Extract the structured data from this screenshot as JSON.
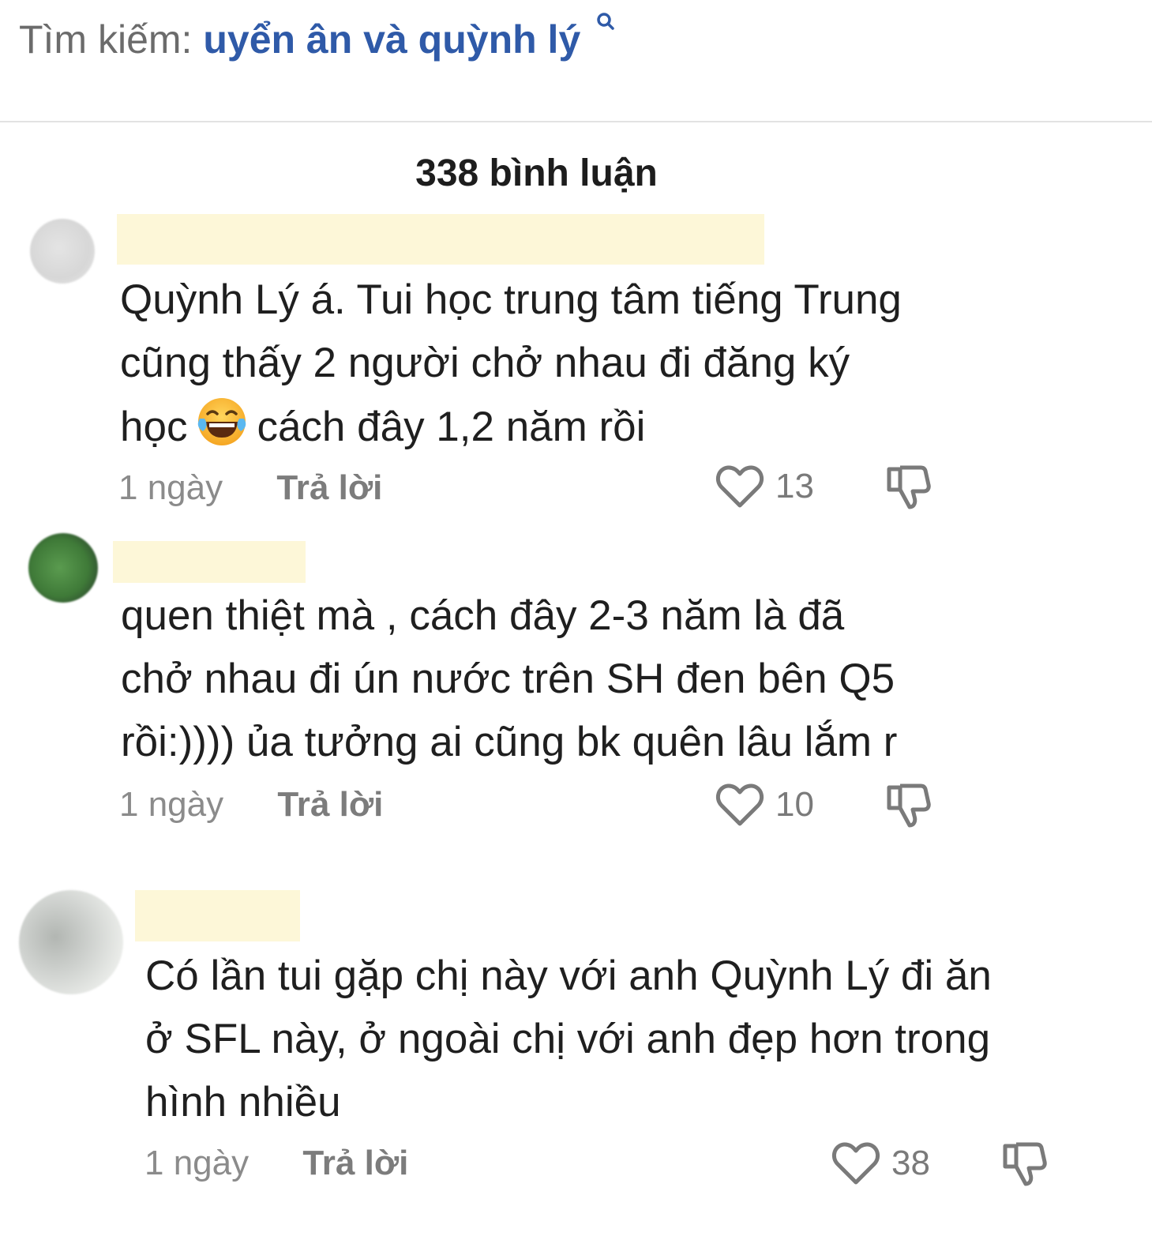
{
  "search": {
    "label": "Tìm kiếm:",
    "query": "uyển ân và quỳnh lý"
  },
  "comments_header": {
    "count_text": "338 bình luận"
  },
  "comments": [
    {
      "text_before_emoji": "Quỳnh Lý á. Tui học trung tâm tiếng Trung\ncũng thấy 2 người chở nhau đi đăng ký\nhọc",
      "emoji": "laughing-crying-emoji",
      "text_after_emoji": "cách đây 1,2 năm rồi",
      "time": "1 ngày",
      "reply_label": "Trả lời",
      "likes": "13"
    },
    {
      "text": "quen thiệt mà , cách đây 2-3 năm là đã\nchở nhau đi ún nước trên SH đen bên Q5\nrồi:)))) ủa tưởng ai cũng bk quên lâu lắm r",
      "time": "1 ngày",
      "reply_label": "Trả lời",
      "likes": "10"
    },
    {
      "text": "Có lần tui gặp chị này với anh Quỳnh Lý đi ăn\nở SFL này, ở ngoài chị với anh đẹp hơn trong\nhình nhiều",
      "time": "1 ngày",
      "reply_label": "Trả lời",
      "likes": "38"
    }
  ],
  "colors": {
    "search_query": "#2f5aa8",
    "redaction": "#fdf7d8",
    "meta_gray": "#8b8b8b"
  },
  "icons": {
    "search": "search-icon",
    "like": "heart-icon",
    "dislike": "thumbs-down-icon",
    "emoji": "laughing-crying-emoji"
  }
}
